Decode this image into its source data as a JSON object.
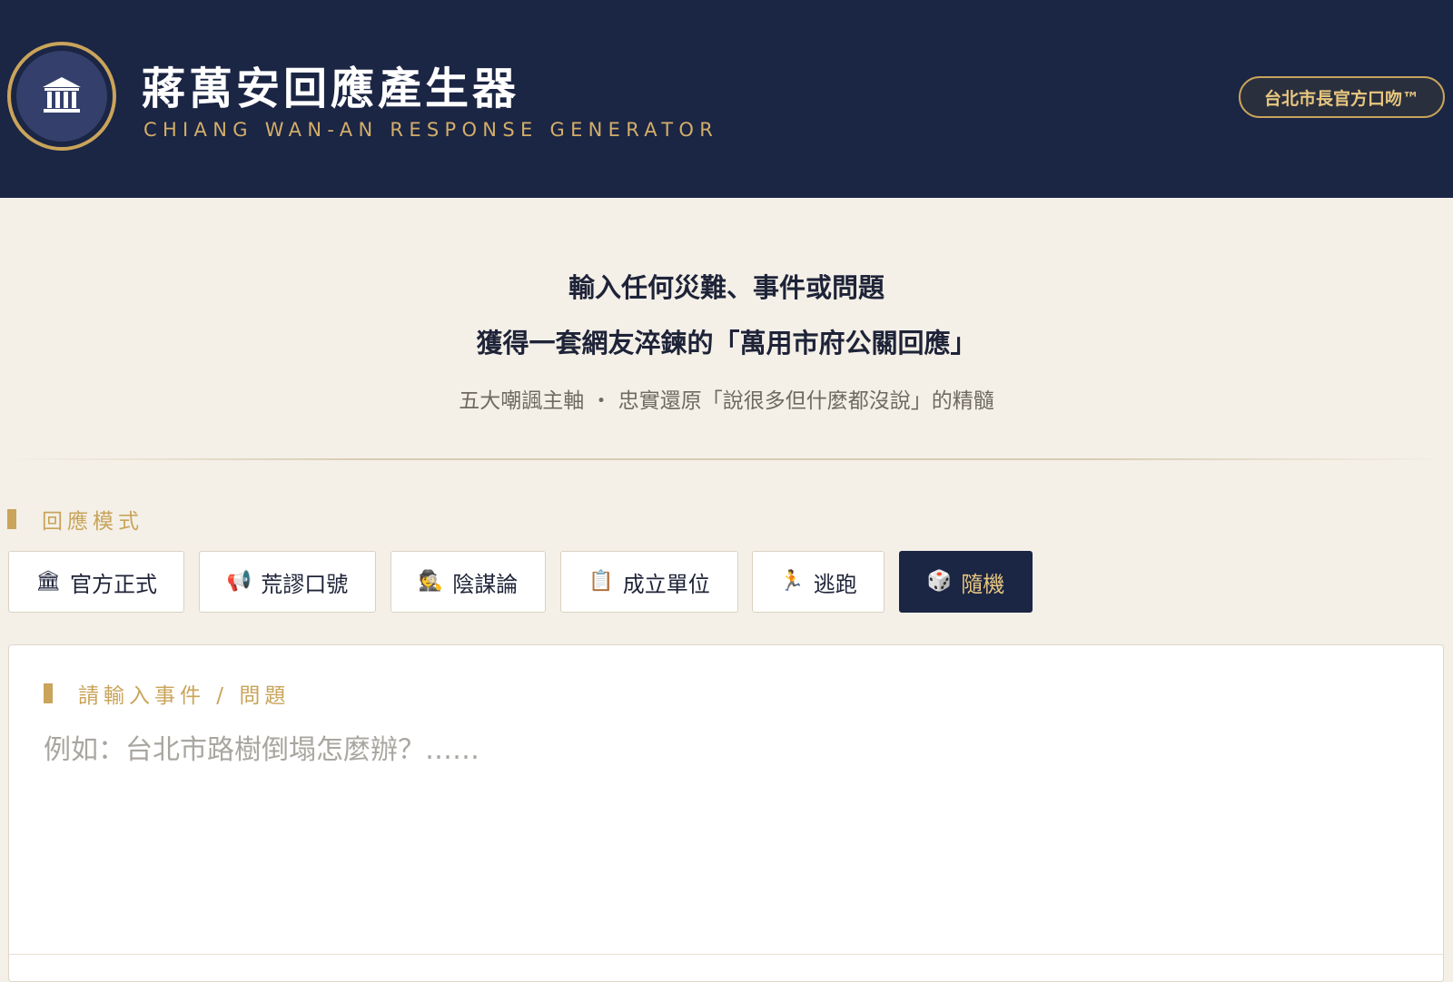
{
  "header": {
    "title": "蔣萬安回應產生器",
    "subtitle": "CHIANG WAN-AN RESPONSE GENERATOR",
    "badge": "台北市長官方口吻™",
    "logo_icon": "government-building-icon"
  },
  "intro": {
    "line1": "輸入任何災難、事件或問題",
    "line2": "獲得一套網友淬鍊的「萬用市府公關回應」",
    "subtitle": "五大嘲諷主軸 ・ 忠實還原「說很多但什麼都沒說」的精髓"
  },
  "mode_section": {
    "label": "回應模式",
    "selected": "隨機",
    "modes": [
      {
        "icon": "🏛",
        "label": "官方正式"
      },
      {
        "icon": "📢",
        "label": "荒謬口號"
      },
      {
        "icon": "🕵",
        "label": "陰謀論"
      },
      {
        "icon": "📋",
        "label": "成立單位"
      },
      {
        "icon": "🏃",
        "label": "逃跑"
      },
      {
        "icon": "🎲",
        "label": "隨機"
      }
    ]
  },
  "input_section": {
    "label": "請輸入事件 / 問題",
    "placeholder": "例如：台北市路樹倒塌怎麼辦？……",
    "value": ""
  },
  "colors": {
    "navy": "#1b2544",
    "gold": "#c9a45a",
    "background": "#f4f0e8"
  }
}
